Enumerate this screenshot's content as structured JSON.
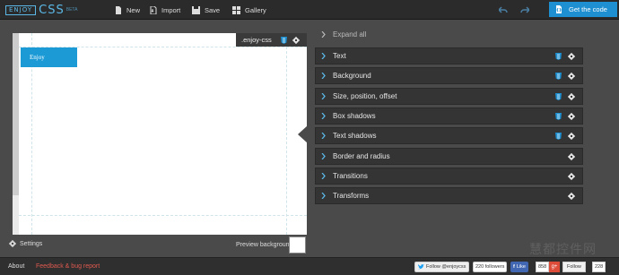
{
  "logo": {
    "box_text": "ENJOY",
    "css_text": "CSS",
    "beta_text": "BETA"
  },
  "toolbar": {
    "new_label": "New",
    "import_label": "Import",
    "save_label": "Save",
    "gallery_label": "Gallery",
    "get_code_label": "Get the code"
  },
  "preview": {
    "tag_label": ".enjoy-css",
    "element_text": "Enjoy",
    "settings_label": "Settings",
    "preview_bg_label": "Preview background"
  },
  "panel": {
    "expand_label": "Expand all",
    "sections": [
      {
        "label": "Text",
        "html5": true
      },
      {
        "label": "Background",
        "html5": true
      },
      {
        "label": "Size, position, offset",
        "html5": true
      },
      {
        "label": "Box shadows",
        "html5": true
      },
      {
        "label": "Text shadows",
        "html5": true
      },
      {
        "label": "Border and radius",
        "html5": false
      },
      {
        "label": "Transitions",
        "html5": false
      },
      {
        "label": "Transforms",
        "html5": false
      }
    ]
  },
  "footer": {
    "about_label": "About",
    "feedback_label": "Feedback & bug report",
    "twitter_label": "Follow @enjoycss",
    "twitter_count": "220 followers",
    "fb_label": "Like",
    "fb_count": "858",
    "gplus_follow_label": "Follow",
    "gplus_count": "228"
  },
  "watermark": "慧都控件网",
  "colors": {
    "accent": "#1e8fd0",
    "element_blue": "#1b9ad6",
    "feedback": "#e05a4f",
    "panel_row": "#343434"
  },
  "icons": [
    "new-icon",
    "import-icon",
    "save-icon",
    "gallery-icon",
    "undo-icon",
    "redo-icon",
    "code-icon",
    "html5-icon",
    "gear-icon",
    "chevron-right-icon",
    "settings-gear-icon",
    "twitter-icon",
    "facebook-icon",
    "gplus-icon"
  ]
}
